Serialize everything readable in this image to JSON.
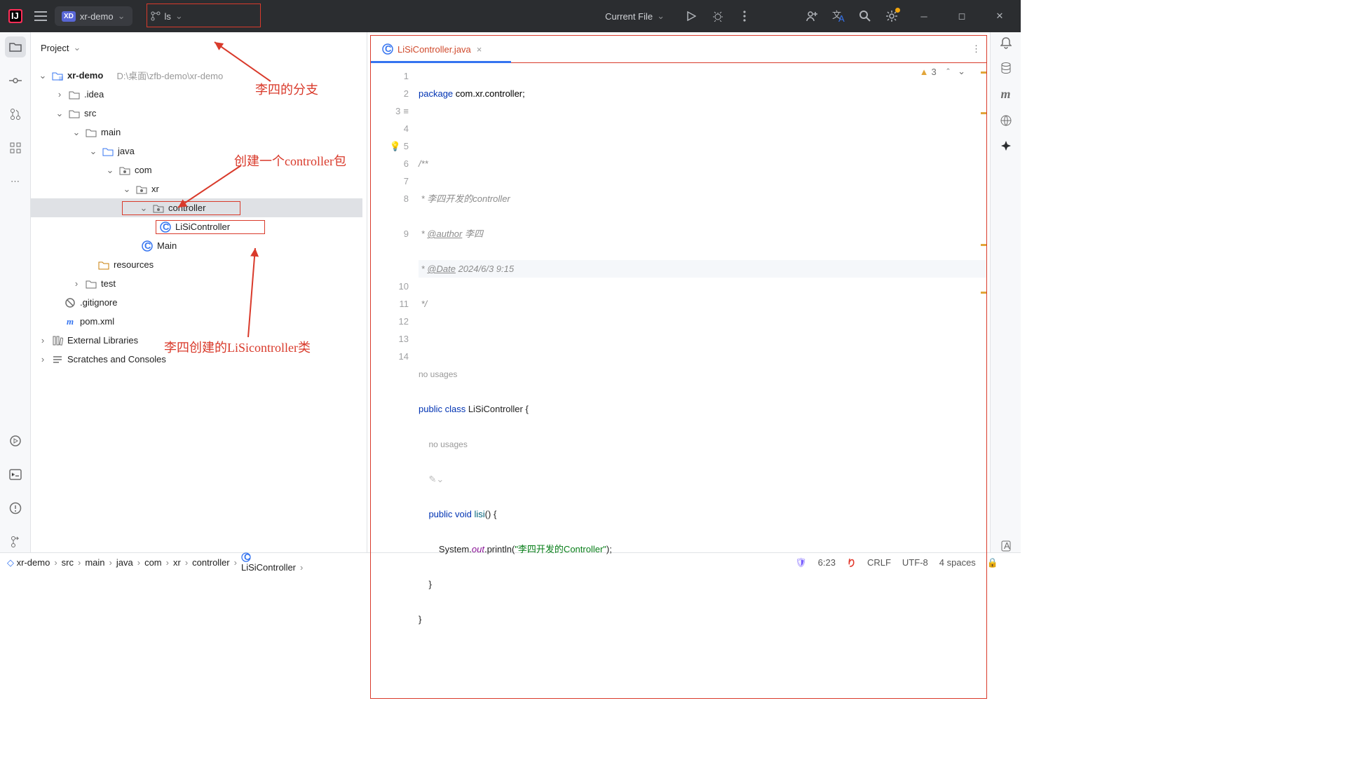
{
  "titlebar": {
    "project": "xr-demo",
    "branch": "ls",
    "runconfig": "Current File"
  },
  "annotations": {
    "branch": "李四的分支",
    "pkg": "创建一个controller包",
    "cls": "李四创建的LiSicontroller类"
  },
  "projectPane": {
    "title": "Project"
  },
  "tree": {
    "root": "xr-demo",
    "rootPath": "D:\\桌面\\zfb-demo\\xr-demo",
    "idea": ".idea",
    "src": "src",
    "main": "main",
    "java": "java",
    "com": "com",
    "xr": "xr",
    "controller": "controller",
    "lisi": "LiSiController",
    "mainCls": "Main",
    "resources": "resources",
    "test": "test",
    "gitignore": ".gitignore",
    "pom": "pom.xml",
    "extlib": "External Libraries",
    "scratch": "Scratches and Consoles"
  },
  "tab": {
    "name": "LiSiController.java"
  },
  "code": {
    "l1a": "package",
    "l1b": " com.xr.controller;",
    "l3": "/**",
    "l4": " * 李四开发的controller",
    "l5a": " * ",
    "l5b": "@author",
    "l5c": " 李四",
    "l6a": " * ",
    "l6b": "@Date",
    "l6c": " 2024/6/3 9:15",
    "l7": " */",
    "nousages": "no usages",
    "l9a": "public class",
    "l9b": " LiSiController {",
    "l10a": "public void",
    "l10b": " lisi",
    "l10c": "() {",
    "l11a": "System.",
    "l11b": "out",
    "l11c": ".println(",
    "l11d": "\"李四开发的Controller\"",
    "l11e": ");",
    "l12": "    }",
    "l13": "}"
  },
  "inspections": {
    "count": "3"
  },
  "breadcrumbs": [
    "xr-demo",
    "src",
    "main",
    "java",
    "com",
    "xr",
    "controller",
    "LiSiController"
  ],
  "status": {
    "pos": "6:23",
    "sep": "CRLF",
    "enc": "UTF-8",
    "indent": "4 spaces"
  }
}
